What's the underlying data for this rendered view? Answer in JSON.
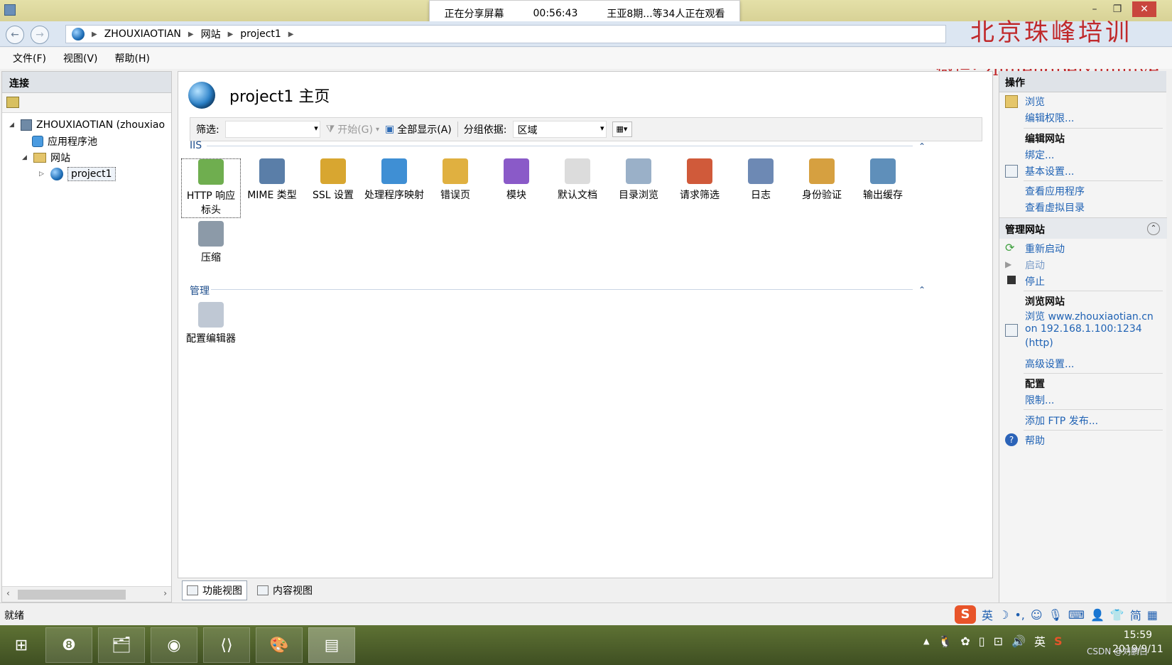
{
  "share_bar": {
    "status": "正在分享屏幕",
    "timer": "00:56:43",
    "viewers": "王亚8期...等34人正在观看"
  },
  "watermark": {
    "line1": "北京珠峰培训",
    "line2": "微信: zhufengpeixunjiuye"
  },
  "breadcrumb": {
    "items": [
      "ZHOUXIAOTIAN",
      "网站",
      "project1"
    ]
  },
  "menu": {
    "file": "文件(F)",
    "view": "视图(V)",
    "help": "帮助(H)"
  },
  "connections": {
    "title": "连接",
    "tree": {
      "server": "ZHOUXIAOTIAN (zhouxiao",
      "app_pools": "应用程序池",
      "sites": "网站",
      "site": "project1"
    }
  },
  "main": {
    "title": "project1 主页",
    "filter": {
      "label": "筛选:",
      "go": "开始(G)",
      "show_all": "全部显示(A)",
      "group_by_label": "分组依据:",
      "group_by_value": "区域"
    },
    "groups": {
      "iis": {
        "label": "IIS",
        "features": [
          {
            "label": "HTTP 响应标头",
            "icon": "http-response-headers-icon"
          },
          {
            "label": "MIME 类型",
            "icon": "mime-types-icon"
          },
          {
            "label": "SSL 设置",
            "icon": "ssl-lock-icon"
          },
          {
            "label": "处理程序映射",
            "icon": "handler-mappings-icon"
          },
          {
            "label": "错误页",
            "icon": "error-pages-icon"
          },
          {
            "label": "模块",
            "icon": "modules-icon"
          },
          {
            "label": "默认文档",
            "icon": "default-document-icon"
          },
          {
            "label": "目录浏览",
            "icon": "directory-browsing-icon"
          },
          {
            "label": "请求筛选",
            "icon": "request-filtering-icon"
          },
          {
            "label": "日志",
            "icon": "logging-icon"
          },
          {
            "label": "身份验证",
            "icon": "authentication-icon"
          },
          {
            "label": "输出缓存",
            "icon": "output-caching-icon"
          },
          {
            "label": "压缩",
            "icon": "compression-icon"
          }
        ]
      },
      "management": {
        "label": "管理",
        "features": [
          {
            "label": "配置编辑器",
            "icon": "configuration-editor-icon"
          }
        ]
      }
    },
    "tabs": {
      "features_view": "功能视图",
      "content_view": "内容视图"
    }
  },
  "actions": {
    "title": "操作",
    "browse": "浏览",
    "edit_permissions": "编辑权限...",
    "edit_site": "编辑网站",
    "bindings": "绑定...",
    "basic_settings": "基本设置...",
    "view_apps": "查看应用程序",
    "view_vdirs": "查看虚拟目录",
    "manage_site": "管理网站",
    "restart": "重新启动",
    "start": "启动",
    "stop": "停止",
    "browse_site": "浏览网站",
    "browse_url_1": "浏览 www.zhouxiaotian.cn",
    "browse_url_2": "on 192.168.1.100:1234",
    "browse_url_3": "(http)",
    "advanced": "高级设置...",
    "config": "配置",
    "limits": "限制...",
    "add_ftp": "添加 FTP 发布...",
    "help": "帮助"
  },
  "status": {
    "text": "就绪"
  },
  "ime": {
    "lang": "英",
    "simplified": "简"
  },
  "tray": {
    "lang": "英"
  },
  "clock": {
    "time": "15:59",
    "date": "2019/9/11"
  },
  "csdn": "CSDN @刘鹏白"
}
